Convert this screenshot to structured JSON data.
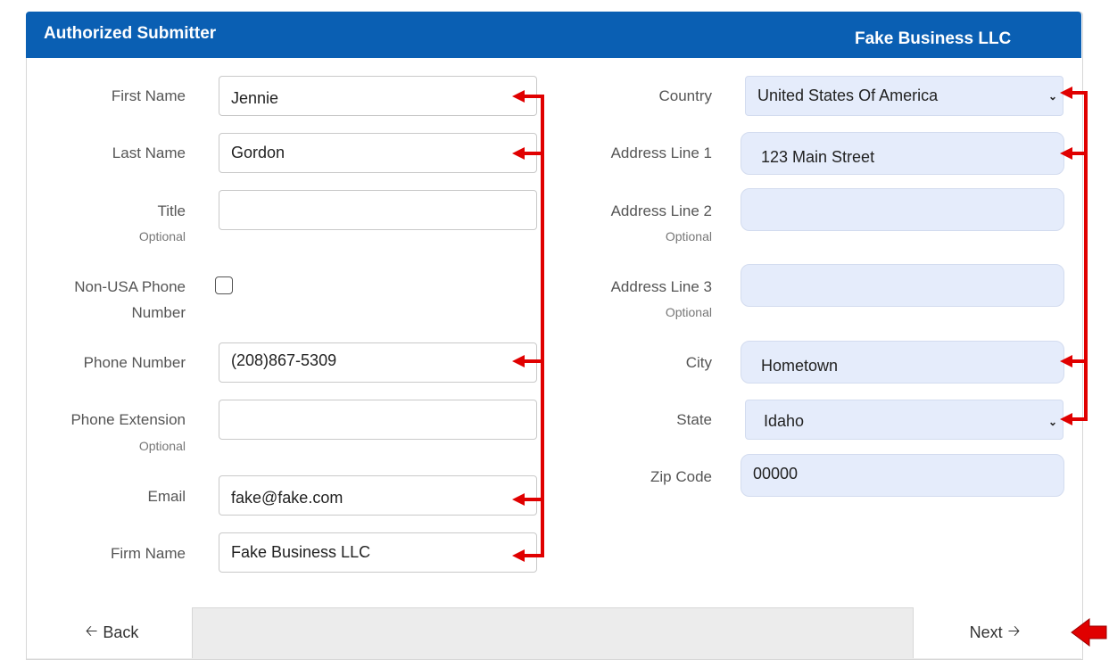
{
  "header": {
    "title": "Authorized Submitter",
    "business_name": "Fake Business LLC"
  },
  "left_form": {
    "first_name": {
      "label": "First Name",
      "value": "Jennie"
    },
    "last_name": {
      "label": "Last Name",
      "value": "Gordon"
    },
    "title": {
      "label": "Title",
      "optional": "Optional",
      "value": ""
    },
    "non_usa_phone": {
      "label_line1": "Non-USA Phone",
      "label_line2": "Number",
      "checked": false
    },
    "phone_number": {
      "label": "Phone Number",
      "value": "(208)867-5309"
    },
    "phone_extension": {
      "label": "Phone Extension",
      "optional": "Optional",
      "value": ""
    },
    "email": {
      "label": "Email",
      "value": "fake@fake.com"
    },
    "firm_name": {
      "label": "Firm Name",
      "value": "Fake Business LLC"
    }
  },
  "right_form": {
    "country": {
      "label": "Country",
      "value": "United States Of America"
    },
    "address1": {
      "label": "Address Line 1",
      "value": "123 Main Street"
    },
    "address2": {
      "label": "Address Line 2",
      "optional": "Optional",
      "value": ""
    },
    "address3": {
      "label": "Address Line 3",
      "optional": "Optional",
      "value": ""
    },
    "city": {
      "label": "City",
      "value": "Hometown"
    },
    "state": {
      "label": "State",
      "value": "Idaho"
    },
    "zip": {
      "label": "Zip Code",
      "value": "00000"
    }
  },
  "footer": {
    "back_label": "Back",
    "next_label": "Next"
  },
  "icons": {
    "back": "arrow-left-icon",
    "next": "arrow-right-icon",
    "select": "chevron-down-icon"
  },
  "colors": {
    "header_bg": "#0a5fb3",
    "annotation_red": "#e00000",
    "filled_field_bg": "#e5ecfb"
  }
}
